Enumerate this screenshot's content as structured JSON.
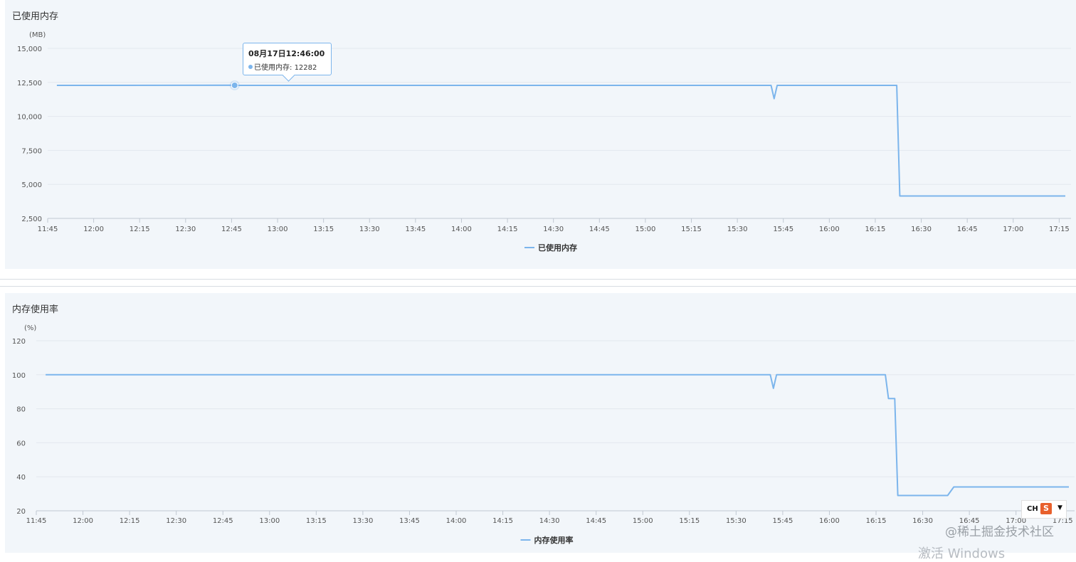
{
  "charts": [
    {
      "title": "已使用内存",
      "unit": "(MB)",
      "legend": "已使用内存",
      "color": "#7cb5ec"
    },
    {
      "title": "内存使用率",
      "unit": "(%)",
      "legend": "内存使用率",
      "color": "#7cb5ec"
    }
  ],
  "tooltip": {
    "date": "08月17日12:46:00",
    "series_label": "已使用内存",
    "value_text": "12282"
  },
  "ime": {
    "label": "CH",
    "icon": "S"
  },
  "watermark": "@稀土掘金技术社区",
  "activate_text": "激活 Windows",
  "chart_data": [
    {
      "type": "line",
      "title": "已使用内存",
      "ylabel": "(MB)",
      "x_ticks": [
        "11:45",
        "12:00",
        "12:15",
        "12:30",
        "12:45",
        "13:00",
        "13:15",
        "13:30",
        "13:45",
        "14:00",
        "14:15",
        "14:30",
        "14:45",
        "15:00",
        "15:15",
        "15:30",
        "15:45",
        "16:00",
        "16:15",
        "16:30",
        "16:45",
        "17:00",
        "17:15"
      ],
      "y_ticks": [
        2500,
        5000,
        7500,
        10000,
        12500,
        15000
      ],
      "y_tick_labels": [
        "2,500",
        "5,000",
        "7,500",
        "10,000",
        "12,500",
        "15,000"
      ],
      "ylim": [
        2500,
        15000
      ],
      "xlim": [
        "11:45",
        "17:17"
      ],
      "grid": true,
      "legend_position": "bottom-center",
      "series": [
        {
          "name": "已使用内存",
          "x": [
            "11:48",
            "12:45",
            "12:46",
            "15:41",
            "15:42",
            "15:43",
            "16:22",
            "16:23",
            "17:17"
          ],
          "y": [
            12282,
            12290,
            12282,
            12282,
            11300,
            12282,
            12282,
            4150,
            4150
          ]
        }
      ],
      "highlight_point": {
        "x": "12:46",
        "y": 12282
      }
    },
    {
      "type": "line",
      "title": "内存使用率",
      "ylabel": "(%)",
      "x_ticks": [
        "11:45",
        "12:00",
        "12:15",
        "12:30",
        "12:45",
        "13:00",
        "13:15",
        "13:30",
        "13:45",
        "14:00",
        "14:15",
        "14:30",
        "14:45",
        "15:00",
        "15:15",
        "15:30",
        "15:45",
        "16:00",
        "16:15",
        "16:30",
        "16:45",
        "17:00",
        "17:15"
      ],
      "y_ticks": [
        20,
        40,
        60,
        80,
        100,
        120
      ],
      "y_tick_labels": [
        "20",
        "40",
        "60",
        "80",
        "100",
        "120"
      ],
      "ylim": [
        20,
        120
      ],
      "xlim": [
        "11:45",
        "17:17"
      ],
      "grid": true,
      "legend_position": "bottom-center",
      "series": [
        {
          "name": "内存使用率",
          "x": [
            "11:48",
            "15:41",
            "15:42",
            "15:43",
            "16:18",
            "16:19",
            "16:21",
            "16:22",
            "16:38",
            "16:40",
            "17:17"
          ],
          "y": [
            100,
            100,
            92,
            100,
            100,
            86,
            86,
            29,
            29,
            34,
            34
          ]
        }
      ]
    }
  ]
}
